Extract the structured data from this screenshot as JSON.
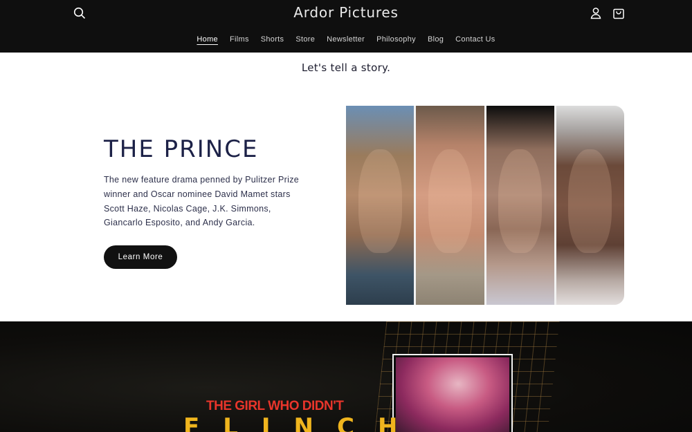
{
  "header": {
    "brand": "Ardor Pictures",
    "icons": {
      "search": "search-icon",
      "account": "user-icon",
      "cart": "bag-icon"
    },
    "nav": [
      {
        "label": "Home",
        "active": true
      },
      {
        "label": "Films"
      },
      {
        "label": "Shorts"
      },
      {
        "label": "Store"
      },
      {
        "label": "Newsletter"
      },
      {
        "label": "Philosophy"
      },
      {
        "label": "Blog"
      },
      {
        "label": "Contact Us"
      }
    ]
  },
  "tagline": "Let's tell a story.",
  "feature": {
    "title": "THE PRINCE",
    "description": "The new feature drama penned by Pulitzer Prize winner and Oscar nominee David Mamet stars Scott Haze, Nicolas Cage, J.K. Simmons, Giancarlo Esposito, and Andy Garcia.",
    "button_label": "Learn More"
  },
  "banner": {
    "subtitle": "THE GIRL WHO DIDN'T",
    "title": "FLINCH"
  },
  "colors": {
    "header_bg": "#0f0f0f",
    "title_navy": "#1c2147",
    "button_bg": "#111111",
    "banner_red": "#e8352b",
    "banner_gold": "#f0b51e"
  }
}
